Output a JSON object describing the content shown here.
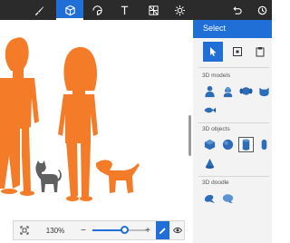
{
  "toolbar": {
    "items": [
      {
        "name": "brushes",
        "icon": "brush-icon"
      },
      {
        "name": "3d-shapes",
        "icon": "cube-icon",
        "active": true
      },
      {
        "name": "stickers",
        "icon": "sticker-icon"
      },
      {
        "name": "text",
        "icon": "text-icon"
      },
      {
        "name": "effects",
        "icon": "grid-icon"
      },
      {
        "name": "canvas",
        "icon": "sun-icon"
      },
      {
        "name": "undo",
        "icon": "undo-icon"
      },
      {
        "name": "history",
        "icon": "history-icon"
      }
    ]
  },
  "panel": {
    "title": "Select",
    "tools": [
      "select-cursor-icon",
      "select-region-icon",
      "paste-icon"
    ],
    "sections": {
      "models": "3D models",
      "objects": "3D objects",
      "doodle": "3D doodle"
    },
    "models": [
      "man-model-icon",
      "woman-model-icon",
      "dog-model-icon",
      "cat-model-icon",
      "fish-model-icon"
    ],
    "objects": [
      "cube-object-icon",
      "sphere-object-icon",
      "cylinder-object-icon",
      "capsule-object-icon",
      "cone-object-icon"
    ],
    "selected_object": "cylinder-object-icon",
    "doodles": [
      "sharp-doodle-icon",
      "soft-doodle-icon"
    ]
  },
  "zoom": {
    "level_label": "130%",
    "level": 0.58,
    "minus": "−",
    "plus": "+"
  },
  "colors": {
    "accent": "#1f6fd6",
    "model_orange": "#f47b27",
    "pet_gray": "#5f5f5f",
    "toolbar_bg": "#2b2b2b",
    "panel_bg": "#f3f3f3"
  }
}
